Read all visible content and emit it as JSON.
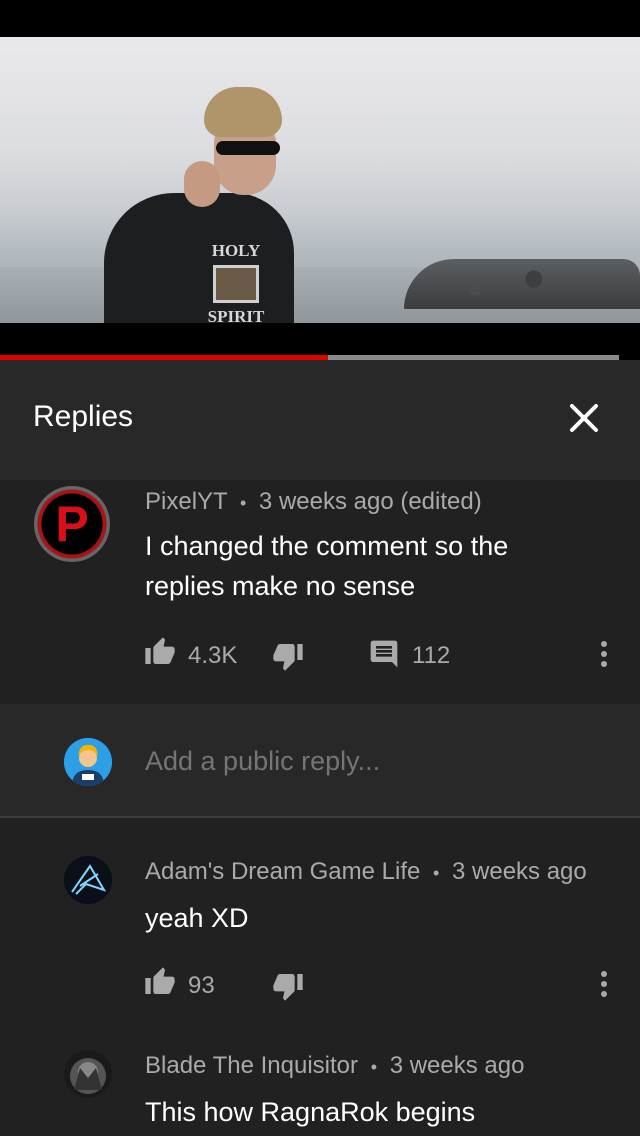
{
  "panel": {
    "title": "Replies"
  },
  "video": {
    "shirt_line1": "HOLY",
    "shirt_line2": "SPIRIT",
    "played_fraction": 0.512,
    "buffered_fraction": 0.967
  },
  "main_comment": {
    "author": "PixelYT",
    "time": "3 weeks ago (edited)",
    "text_line1": "I changed the comment so the",
    "text_line2": "replies make no sense",
    "likes": "4.3K",
    "reply_count": "112",
    "avatar_letter": "P"
  },
  "add_reply": {
    "placeholder": "Add a public reply..."
  },
  "replies": [
    {
      "author": "Adam's Dream Game Life",
      "time": "3 weeks ago",
      "text": "yeah XD",
      "likes": "93"
    },
    {
      "author": "Blade The Inquisitor",
      "time": "3 weeks ago",
      "text": "This how RagnaRok begins"
    }
  ],
  "separator": "•",
  "colors": {
    "background": "#212121",
    "header": "#282828",
    "progress_played": "#e00000",
    "progress_buffer": "#8a8a8a",
    "secondary_text": "#aaaaaa"
  },
  "icons": {
    "close": "close-icon",
    "like": "thumb-up-icon",
    "dislike": "thumb-down-icon",
    "reply": "comment-icon",
    "more": "more-vert-icon"
  }
}
